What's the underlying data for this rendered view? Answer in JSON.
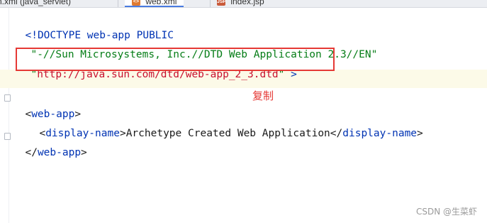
{
  "tabs": [
    {
      "label": "n.xml (java_servlet)",
      "icon": "",
      "active": false
    },
    {
      "label": "web.xml",
      "icon": "xml-file-icon",
      "active": true
    },
    {
      "label": "index.jsp",
      "icon": "jsp-file-icon",
      "active": false
    }
  ],
  "code": {
    "line1": {
      "prefix": "<!",
      "keyword": "DOCTYPE",
      "rest": " web-app PUBLIC"
    },
    "line2": {
      "string": "\"-//Sun Microsystems, Inc.//DTD Web Application 2.3//EN\""
    },
    "line3": {
      "quote_open": "\"",
      "url": "http://java.sun.com/dtd/web-app_2_3.dtd",
      "quote_close": "\"",
      "close": " >"
    },
    "line5": {
      "open": "<",
      "tag": "web-app",
      "close": ">"
    },
    "line6": {
      "open": "<",
      "tag": "display-name",
      "close": ">",
      "text": "Archetype Created Web Application",
      "end_open": "</",
      "end_tag": "display-name",
      "end_close": ">"
    },
    "line7": {
      "open": "</",
      "tag": "web-app",
      "close": ">"
    }
  },
  "annotation": {
    "label": "复制",
    "color": "#e53935"
  },
  "watermark": "CSDN @生菜虾",
  "colors": {
    "keyword": "#0033b3",
    "string": "#067d17",
    "url": "#c8102e",
    "highlight_border": "#e53935",
    "current_line": "#fcfae8"
  }
}
